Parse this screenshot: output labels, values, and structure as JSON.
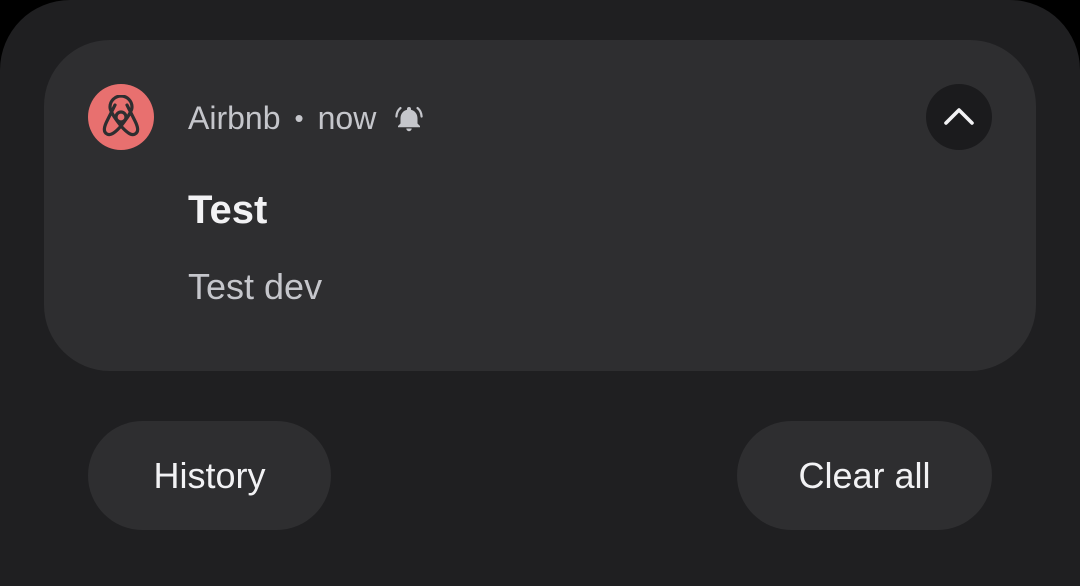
{
  "notification": {
    "app_name": "Airbnb",
    "separator": "•",
    "time": "now",
    "title": "Test",
    "body": "Test dev",
    "app_icon": "airbnb-logo-icon",
    "alert_icon": "bell-alert-icon",
    "expand_icon": "chevron-up-icon",
    "icon_color": "#e8706f"
  },
  "actions": {
    "history_label": "History",
    "clear_all_label": "Clear all"
  },
  "colors": {
    "shade_background": "#1f1f21",
    "card_background": "#2e2e30",
    "primary_text": "#f2f2f4",
    "secondary_text": "#c5c6cb"
  }
}
